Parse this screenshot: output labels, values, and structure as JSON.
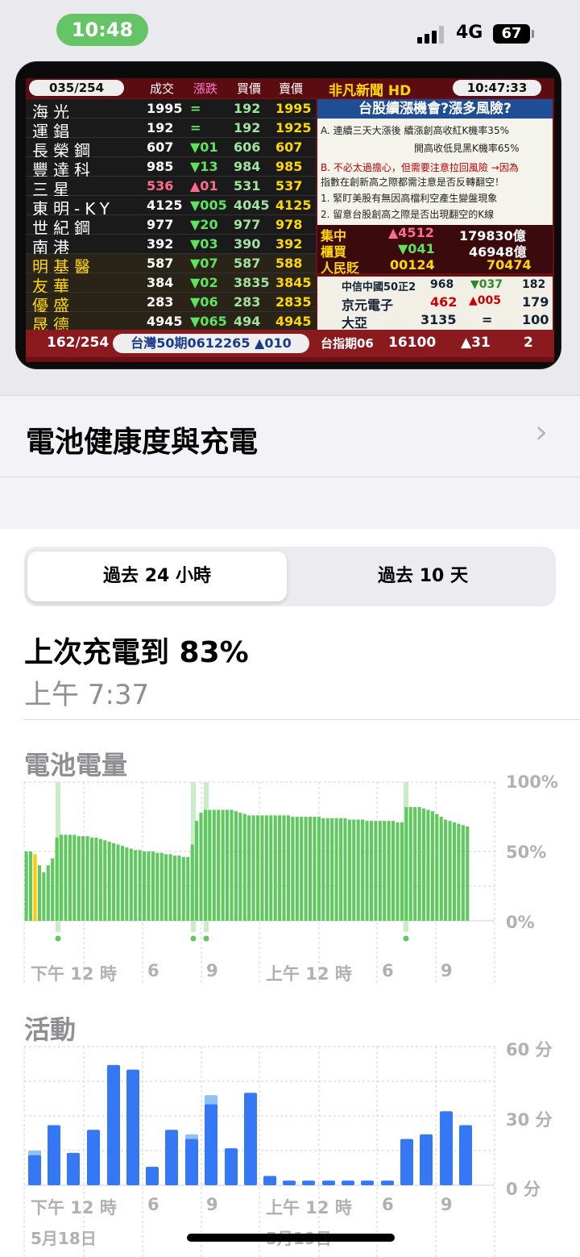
{
  "status": {
    "time": "10:48",
    "network": "4G",
    "battery": "67"
  },
  "tv": {
    "count": "035/254",
    "cols": [
      "成交",
      "漲跌",
      "買價",
      "賣價"
    ],
    "logo": "非凡新聞 HD",
    "clock": "10:47:33",
    "rows": [
      {
        "name": "海光",
        "price": "1995",
        "chg": "=",
        "bid": "192",
        "ask": "1995"
      },
      {
        "name": "運錩",
        "price": "192",
        "chg": "=",
        "bid": "192",
        "ask": "1925"
      },
      {
        "name": "長榮鋼",
        "price": "607",
        "chg": "▼01",
        "bid": "606",
        "ask": "607"
      },
      {
        "name": "豐達科",
        "price": "985",
        "chg": "▼13",
        "bid": "984",
        "ask": "985"
      },
      {
        "name": "三星",
        "price": "536",
        "chg": "▲01",
        "bid": "531",
        "ask": "537"
      },
      {
        "name": "東明-KY",
        "price": "4125",
        "chg": "▼005",
        "bid": "4045",
        "ask": "4125"
      },
      {
        "name": "世紀鋼",
        "price": "977",
        "chg": "▼20",
        "bid": "977",
        "ask": "978"
      },
      {
        "name": "南港",
        "price": "392",
        "chg": "▼03",
        "bid": "390",
        "ask": "392"
      },
      {
        "name": "明基醫",
        "price": "587",
        "chg": "▼07",
        "bid": "587",
        "ask": "588"
      },
      {
        "name": "友華",
        "price": "384",
        "chg": "▼02",
        "bid": "3835",
        "ask": "3845"
      },
      {
        "name": "優盛",
        "price": "283",
        "chg": "▼06",
        "bid": "283",
        "ask": "2835"
      },
      {
        "name": "晟德",
        "price": "4945",
        "chg": "▼065",
        "bid": "494",
        "ask": "4945"
      }
    ],
    "news_title": "台股續漲機會?漲多風險?",
    "news_lines": [
      "A. 連續三天大漲後 續漲創高收紅K機率35%",
      "開高收低見黑K機率65%",
      "B. 不必太過擔心，但需要注意拉回風險 →因為",
      "指數在創新高之際都需注意是否反轉翻空！",
      "1. 緊盯美股有無因高檔利空產生變盤現象",
      "2. 留意台股創高之際是否出現翻空的K線"
    ],
    "market": [
      {
        "label": "集中",
        "chg": "▲4512",
        "val": "179830億"
      },
      {
        "label": "櫃買",
        "chg": "▼041",
        "val": "46948億"
      },
      {
        "label": "人民貶",
        "chg": "00124",
        "val": "70474"
      }
    ],
    "stocks": [
      {
        "label": "中信中國50正2",
        "a": "968",
        "b": "▼037",
        "c": "182"
      },
      {
        "label": "京元電子",
        "a": "462",
        "b": "▲005",
        "c": "179"
      },
      {
        "label": "大亞",
        "a": "3135",
        "b": "=",
        "c": "100"
      }
    ],
    "footer": {
      "count": "162/254",
      "ticker": "台灣50期0612265 ▲010",
      "index": "台指期06",
      "index_val": "16100",
      "index_chg": "▲31",
      "index_n": "2"
    }
  },
  "settings": {
    "battery_health": "電池健康度與充電"
  },
  "segment": {
    "opt1": "過去 24 小時",
    "opt2": "過去 10 天"
  },
  "last_charge": {
    "title": "上次充電到 83%",
    "time": "上午 7:37"
  },
  "battery_chart": {
    "title": "電池電量",
    "y_ticks": [
      "100%",
      "50%",
      "0%"
    ],
    "x_ticks": [
      "下午 12 時",
      "6",
      "9",
      "上午 12 時",
      "6",
      "9"
    ]
  },
  "activity_chart": {
    "title": "活動",
    "y_ticks": [
      "60 分",
      "30 分",
      "0 分"
    ],
    "x_ticks": [
      "下午 12 時",
      "6",
      "9",
      "上午 12 時",
      "6",
      "9"
    ],
    "dates": [
      "5月18日",
      "5月19日"
    ]
  },
  "chart_data": [
    {
      "type": "bar",
      "title": "電池電量",
      "ylim": [
        0,
        100
      ],
      "unit": "%",
      "values": [
        50,
        50,
        48,
        40,
        35,
        40,
        45,
        60,
        62,
        62,
        62,
        62,
        61,
        61,
        61,
        60,
        60,
        59,
        58,
        57,
        56,
        55,
        54,
        53,
        52,
        51,
        51,
        50,
        50,
        50,
        49,
        49,
        48,
        48,
        47,
        47,
        46,
        46,
        55,
        72,
        78,
        80,
        80,
        80,
        80,
        80,
        80,
        80,
        79,
        78,
        77,
        76,
        76,
        76,
        76,
        76,
        76,
        76,
        76,
        76,
        76,
        75,
        75,
        75,
        75,
        75,
        75,
        75,
        74,
        74,
        74,
        74,
        74,
        74,
        73,
        73,
        73,
        73,
        72,
        72,
        72,
        72,
        72,
        72,
        72,
        71,
        71,
        82,
        82,
        82,
        82,
        81,
        80,
        79,
        77,
        75,
        73,
        72,
        71,
        70,
        69,
        68
      ],
      "highlight_index": 2,
      "highlight_color": "#ffc800",
      "bar_color": "#5fc85f"
    },
    {
      "type": "bar",
      "title": "活動",
      "ylim": [
        0,
        60
      ],
      "unit": "分",
      "values": [
        13,
        26,
        14,
        24,
        52,
        50,
        8,
        24,
        20,
        35,
        16,
        40,
        4,
        2,
        2,
        2,
        2,
        2,
        2,
        20,
        22,
        32,
        26,
        18
      ],
      "light_values": [
        2,
        0,
        0,
        0,
        0,
        0,
        0,
        0,
        2,
        4,
        0,
        0,
        0,
        0,
        0,
        0,
        0,
        0,
        0,
        0,
        0,
        0,
        0,
        0
      ],
      "bar_color": "#3478f6",
      "light_color": "#8ec2f8"
    }
  ]
}
